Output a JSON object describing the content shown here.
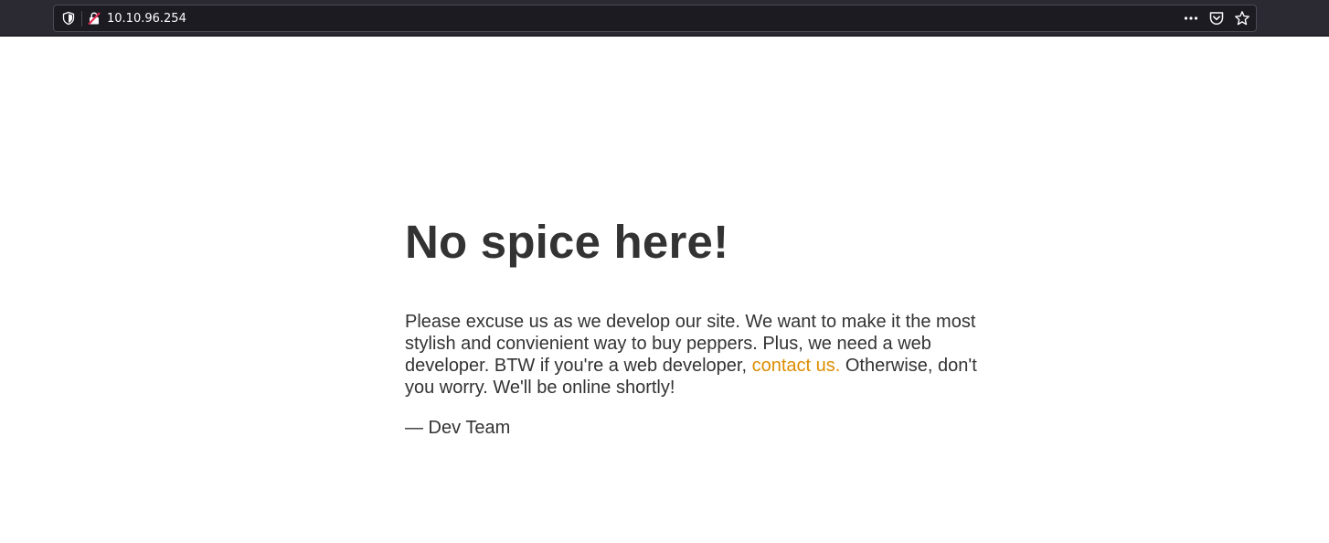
{
  "browser": {
    "url": "10.10.96.254",
    "icons": {
      "tracking_protection": "shield-icon",
      "connection": "insecure-lock-icon",
      "page_actions": "more-actions-icon",
      "pocket": "pocket-icon",
      "bookmark": "star-icon"
    },
    "colors": {
      "toolbar": "#2b2a33",
      "urlbar": "#1c1b22",
      "url_text": "#fbfbfe"
    }
  },
  "page": {
    "heading": "No spice here!",
    "body_before_link": "Please excuse us as we develop our site. We want to make it the most stylish and convienient way to buy peppers. Plus, we need a web developer. BTW if you're a web developer, ",
    "link_text": "contact us.",
    "body_after_link": " Otherwise, don't you worry. We'll be online shortly!",
    "signature": "— Dev Team",
    "colors": {
      "text": "#333333",
      "link": "#dd8d00",
      "background": "#ffffff"
    }
  }
}
